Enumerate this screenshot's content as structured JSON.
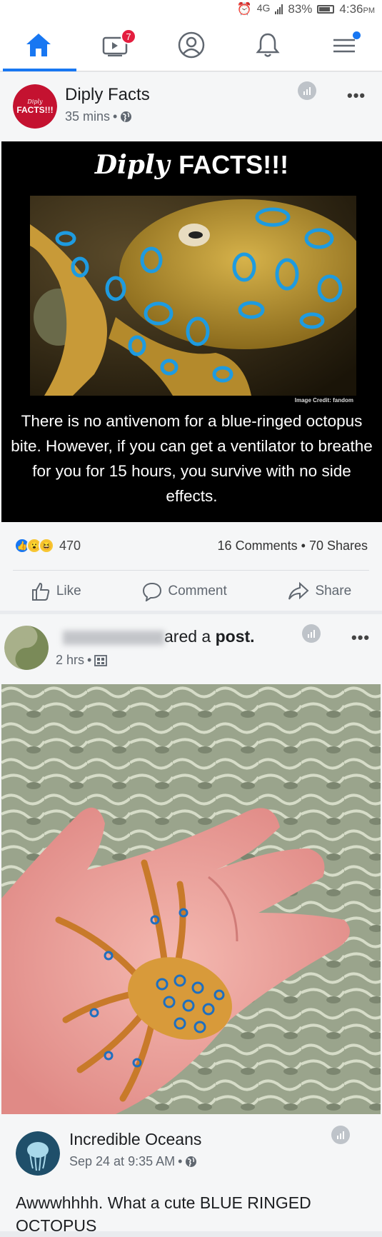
{
  "status_bar": {
    "network": "4G",
    "battery": "83%",
    "time": "4:36",
    "ampm": "PM"
  },
  "nav": {
    "notifications_count": "7",
    "icons": [
      "home-icon",
      "video-icon",
      "profile-icon",
      "bell-icon",
      "menu-icon"
    ]
  },
  "post1": {
    "page_name": "Diply Facts",
    "avatar_text": "Diply FACTS!!!",
    "timestamp": "35 mins",
    "separator": "•",
    "image_title_a": "Diply ",
    "image_title_b": "FACTS!!!",
    "image_credit": "Image Credit: fandom",
    "fact_text": "There is no antivenom for a blue-ringed octopus bite. However, if you can get a ventilator to breathe for you for 15 hours, you survive with no side effects.",
    "reaction_count": "470",
    "comments": "16 Comments",
    "shares": "70 Shares",
    "count_separator": "•",
    "like_label": "Like",
    "comment_label": "Comment",
    "share_label": "Share"
  },
  "post2": {
    "shared_text_a": "ared a ",
    "shared_text_b": "post.",
    "timestamp": "2 hrs",
    "separator": "•"
  },
  "post3": {
    "page_name": "Incredible Oceans",
    "timestamp": "Sep 24 at 9:35 AM",
    "separator": "•",
    "caption": "Awwwhhhh. What a cute BLUE RINGED OCTOPUS"
  },
  "colors": {
    "accent": "#1877f2",
    "badge": "#e41e3f",
    "text": "#1c1e21",
    "meta": "#606770"
  }
}
